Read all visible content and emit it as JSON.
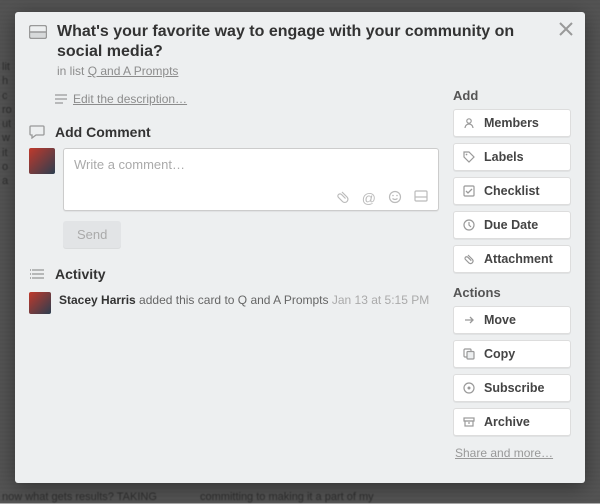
{
  "card": {
    "title": "What's your favorite way to engage with your community on social media?",
    "in_list_prefix": "in list ",
    "list_name": "Q and A Prompts",
    "edit_description": "Edit the description…"
  },
  "comment": {
    "heading": "Add Comment",
    "placeholder": "Write a comment…",
    "send": "Send"
  },
  "activity": {
    "heading": "Activity",
    "entries": [
      {
        "who": "Stacey Harris",
        "did": " added this card to Q and A Prompts ",
        "when": "Jan 13 at 5:15 PM"
      }
    ]
  },
  "sidebar": {
    "add_heading": "Add",
    "add": [
      {
        "label": "Members"
      },
      {
        "label": "Labels"
      },
      {
        "label": "Checklist"
      },
      {
        "label": "Due Date"
      },
      {
        "label": "Attachment"
      }
    ],
    "actions_heading": "Actions",
    "actions": [
      {
        "label": "Move"
      },
      {
        "label": "Copy"
      },
      {
        "label": "Subscribe"
      },
      {
        "label": "Archive"
      }
    ],
    "share_more": "Share and more…"
  }
}
